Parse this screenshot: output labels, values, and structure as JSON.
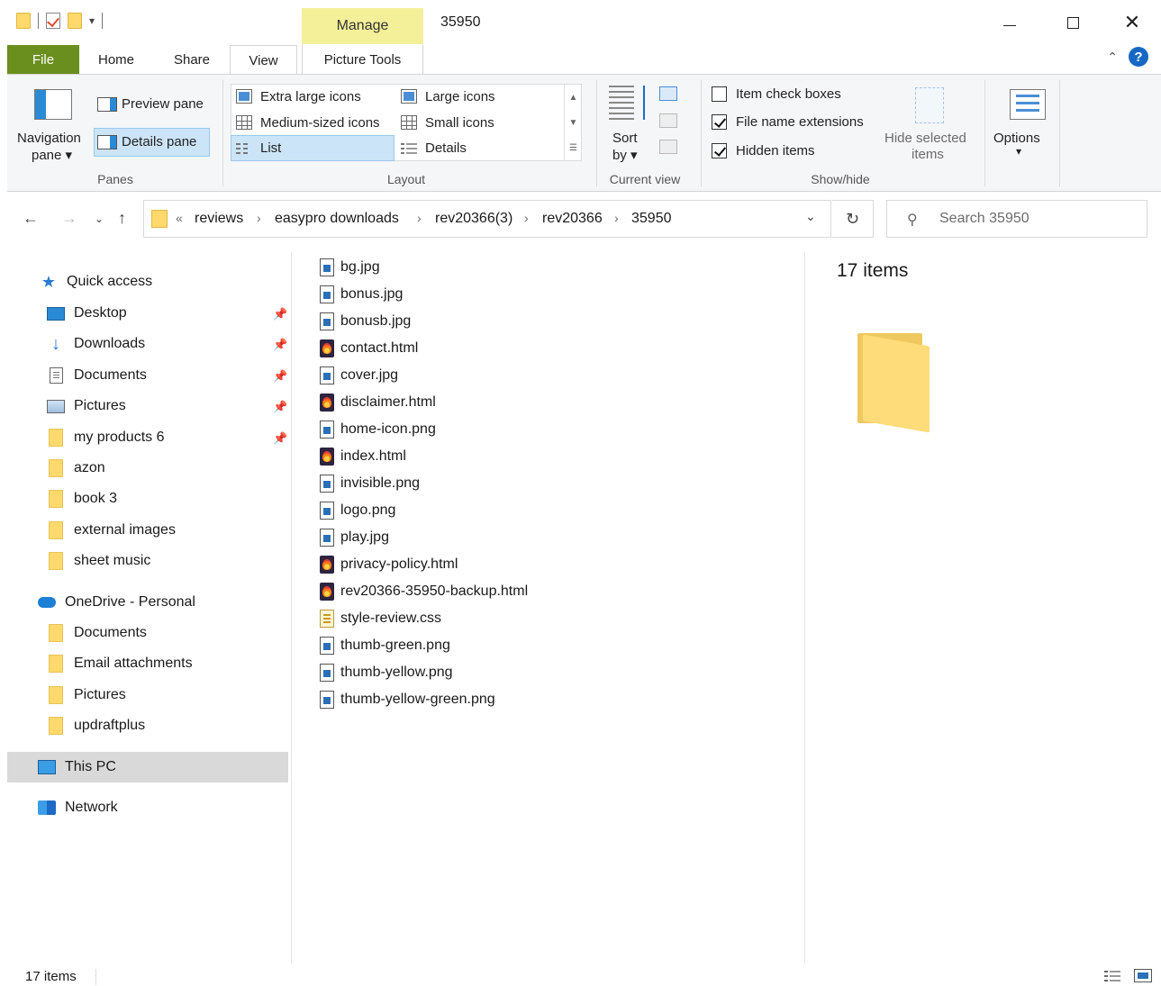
{
  "window": {
    "title": "35950",
    "contextual_tab": "Manage",
    "controls": {
      "minimize": "minimize",
      "maximize": "maximize",
      "close": "close"
    }
  },
  "ribbon_tabs": [
    "File",
    "Home",
    "Share",
    "View",
    "Picture Tools"
  ],
  "ribbon": {
    "panes": {
      "label": "Panes",
      "navigation_pane_line1": "Navigation",
      "navigation_pane_line2": "pane ▾",
      "preview_pane": "Preview pane",
      "details_pane": "Details pane"
    },
    "layout": {
      "label": "Layout",
      "options": [
        "Extra large icons",
        "Large icons",
        "Medium-sized icons",
        "Small icons",
        "List",
        "Details"
      ],
      "selected": "List"
    },
    "current_view": {
      "label": "Current view",
      "sort_line1": "Sort",
      "sort_line2": "by ▾"
    },
    "show_hide": {
      "label": "Show/hide",
      "item_check_boxes": "Item check boxes",
      "item_check_boxes_checked": false,
      "file_name_extensions": "File name extensions",
      "file_name_extensions_checked": true,
      "hidden_items": "Hidden items",
      "hidden_items_checked": true,
      "hide_selected_line1": "Hide selected",
      "hide_selected_line2": "items"
    },
    "options": {
      "label": "Options",
      "arrow": "▾"
    }
  },
  "address": {
    "overflow": "«",
    "breadcrumbs": [
      "reviews",
      "easypro downloads",
      "rev20366(3)",
      "rev20366",
      "35950"
    ],
    "search_placeholder": "Search 35950"
  },
  "nav_pane": {
    "quick_access": "Quick access",
    "quick_items": [
      "Desktop",
      "Downloads",
      "Documents",
      "Pictures",
      "my products 6",
      "azon",
      "book 3",
      "external images",
      "sheet music"
    ],
    "onedrive": "OneDrive - Personal",
    "onedrive_items": [
      "Documents",
      "Email attachments",
      "Pictures",
      "updraftplus"
    ],
    "this_pc": "This PC",
    "network": "Network"
  },
  "files": [
    {
      "name": "bg.jpg",
      "type": "img"
    },
    {
      "name": "bonus.jpg",
      "type": "img"
    },
    {
      "name": "bonusb.jpg",
      "type": "img"
    },
    {
      "name": "contact.html",
      "type": "html"
    },
    {
      "name": "cover.jpg",
      "type": "img"
    },
    {
      "name": "disclaimer.html",
      "type": "html"
    },
    {
      "name": "home-icon.png",
      "type": "img"
    },
    {
      "name": "index.html",
      "type": "html"
    },
    {
      "name": "invisible.png",
      "type": "img"
    },
    {
      "name": "logo.png",
      "type": "img"
    },
    {
      "name": "play.jpg",
      "type": "img"
    },
    {
      "name": "privacy-policy.html",
      "type": "html"
    },
    {
      "name": "rev20366-35950-backup.html",
      "type": "html"
    },
    {
      "name": "style-review.css",
      "type": "css"
    },
    {
      "name": "thumb-green.png",
      "type": "img"
    },
    {
      "name": "thumb-yellow.png",
      "type": "img"
    },
    {
      "name": "thumb-yellow-green.png",
      "type": "img"
    }
  ],
  "details_pane": {
    "count": "17 items"
  },
  "status_bar": {
    "count": "17 items"
  },
  "colors": {
    "file_tab": "#6a8f1e",
    "manage_tab": "#f4f09a",
    "selection": "#cce4f7",
    "folder": "#ffd96b",
    "accent": "#1668c4"
  }
}
